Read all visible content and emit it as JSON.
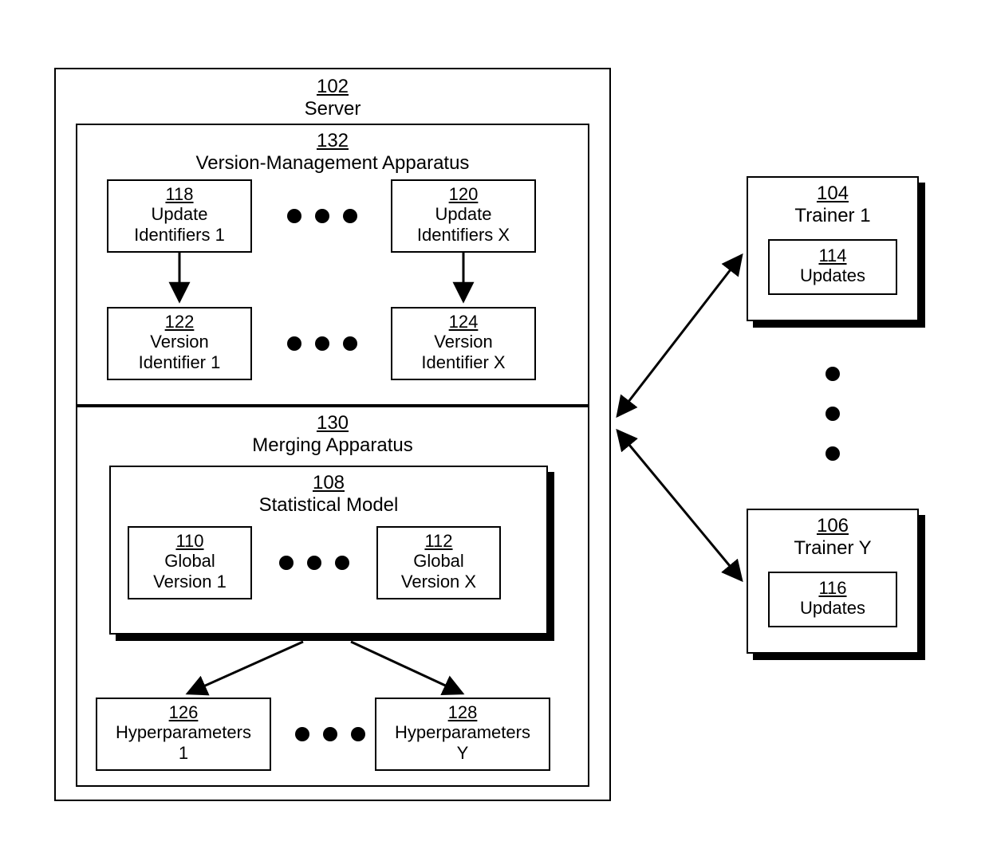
{
  "server": {
    "ref": "102",
    "name": "Server"
  },
  "vm_apparatus": {
    "ref": "132",
    "name": "Version-Management Apparatus"
  },
  "update_ids_1": {
    "ref": "118",
    "name1": "Update",
    "name2": "Identifiers 1"
  },
  "update_ids_x": {
    "ref": "120",
    "name1": "Update",
    "name2": "Identifiers X"
  },
  "version_id_1": {
    "ref": "122",
    "name1": "Version",
    "name2": "Identifier 1"
  },
  "version_id_x": {
    "ref": "124",
    "name1": "Version",
    "name2": "Identifier X"
  },
  "merging_apparatus": {
    "ref": "130",
    "name": "Merging Apparatus"
  },
  "stat_model": {
    "ref": "108",
    "name": "Statistical Model"
  },
  "global_v1": {
    "ref": "110",
    "name1": "Global",
    "name2": "Version 1"
  },
  "global_vx": {
    "ref": "112",
    "name1": "Global",
    "name2": "Version X"
  },
  "hyper_1": {
    "ref": "126",
    "name1": "Hyperparameters",
    "name2": "1"
  },
  "hyper_y": {
    "ref": "128",
    "name1": "Hyperparameters",
    "name2": "Y"
  },
  "trainer_1": {
    "ref": "104",
    "name": "Trainer 1"
  },
  "trainer_y": {
    "ref": "106",
    "name": "Trainer Y"
  },
  "updates_1": {
    "ref": "114",
    "name": "Updates"
  },
  "updates_y": {
    "ref": "116",
    "name": "Updates"
  }
}
